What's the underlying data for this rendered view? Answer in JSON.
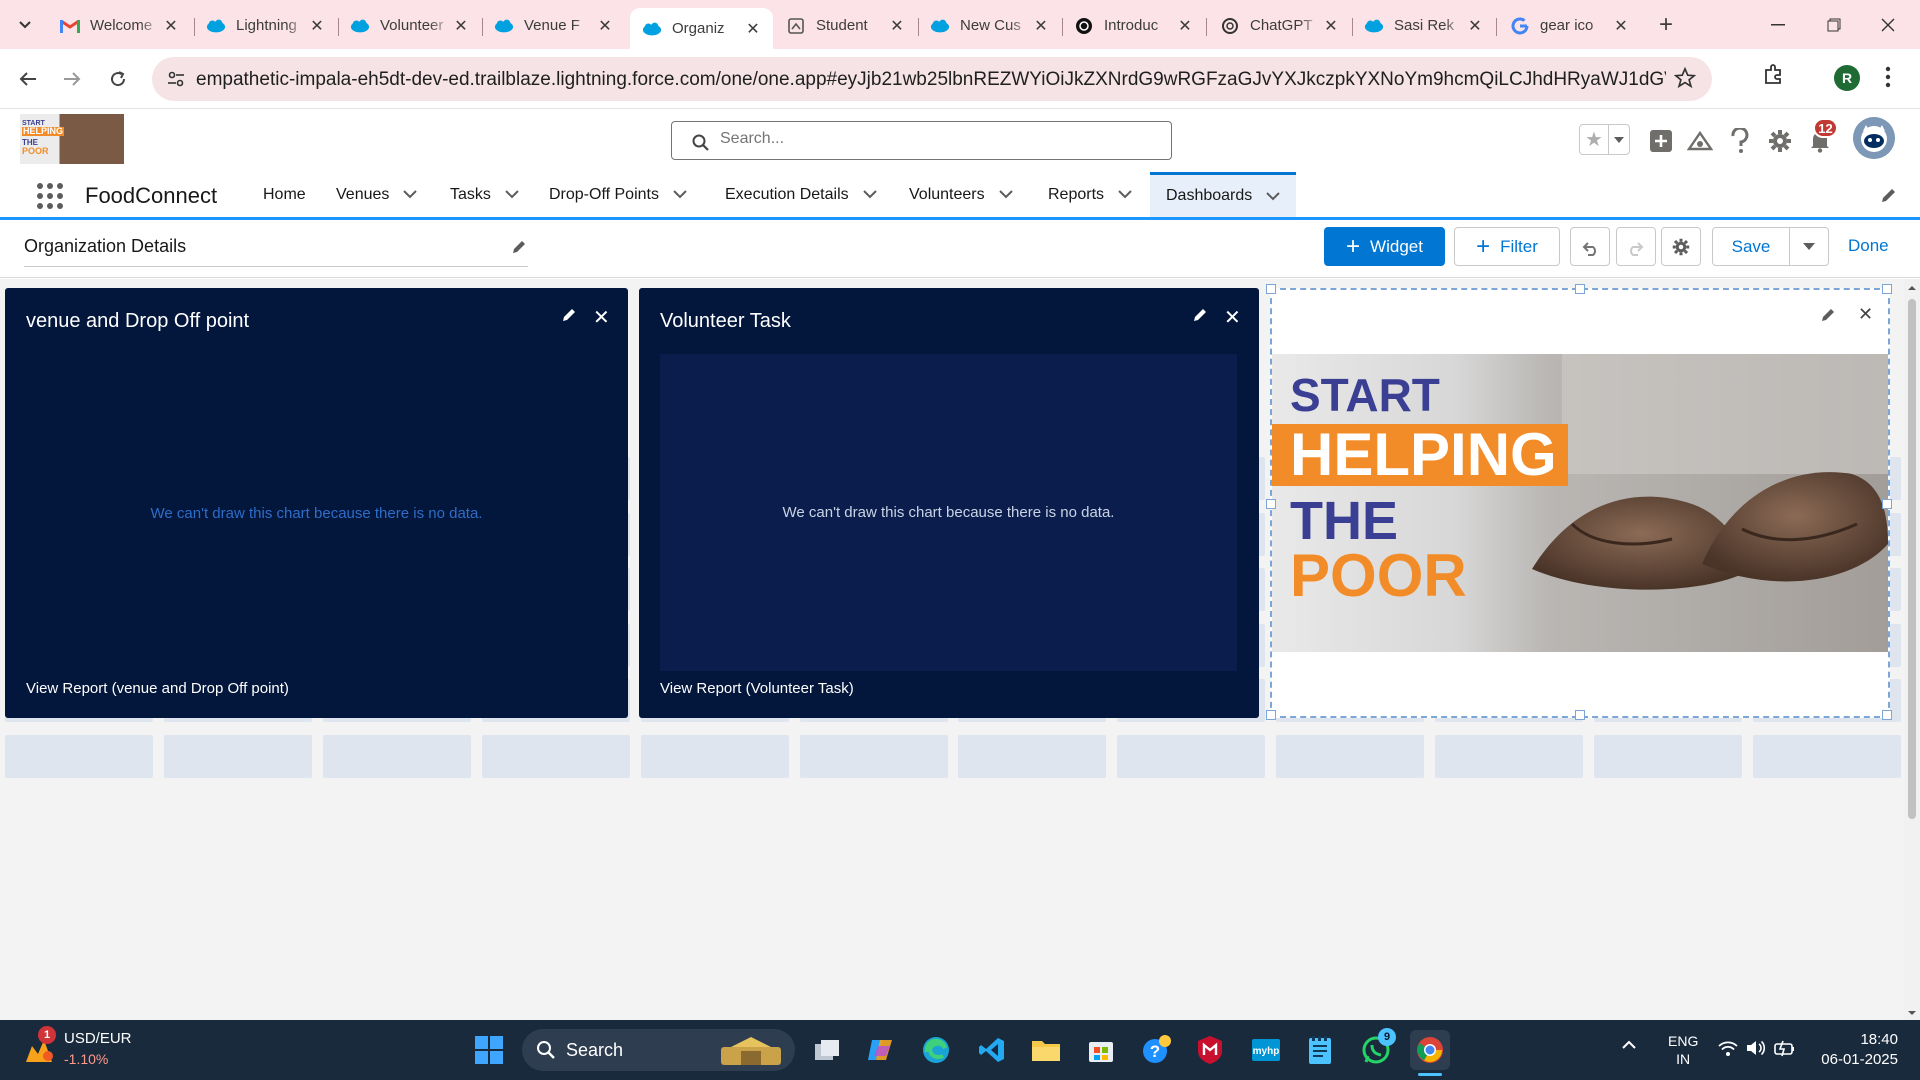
{
  "browser": {
    "tabs": [
      {
        "title": "Welcome",
        "icon": "gmail-icon"
      },
      {
        "title": "Lightning",
        "icon": "salesforce-icon"
      },
      {
        "title": "Volunteer",
        "icon": "salesforce-icon"
      },
      {
        "title": "Venue F",
        "icon": "salesforce-icon"
      },
      {
        "title": "Organiz",
        "icon": "salesforce-icon",
        "active": true
      },
      {
        "title": "Student",
        "icon": "document-icon"
      },
      {
        "title": "New Cus",
        "icon": "salesforce-icon"
      },
      {
        "title": "Introduc",
        "icon": "openai-icon"
      },
      {
        "title": "ChatGPT",
        "icon": "openai-icon"
      },
      {
        "title": "Sasi Rek",
        "icon": "salesforce-icon"
      },
      {
        "title": "gear ico",
        "icon": "google-icon"
      }
    ],
    "url": "empathetic-impala-eh5dt-dev-ed.trailblaze.lightning.force.com/one/one.app#eyJjb21wb25lbnREZWYiOiJkZXNrdG9wRGFzaGJvYXJkczpkYXNoYm9hcmQiLCJhdHRyaWJ1dGVzIjp7ImRhc2hib2FyZ...",
    "profile_initial": "R"
  },
  "logo": {
    "line1": "START",
    "line2": "HELPING",
    "line3": "THE",
    "line4": "POOR"
  },
  "search": {
    "placeholder": "Search..."
  },
  "header": {
    "notification_count": "12"
  },
  "app": {
    "name": "FoodConnect",
    "nav": [
      {
        "label": "Home",
        "dropdown": false
      },
      {
        "label": "Venues",
        "dropdown": true
      },
      {
        "label": "Tasks",
        "dropdown": true
      },
      {
        "label": "Drop-Off Points",
        "dropdown": true
      },
      {
        "label": "Execution Details",
        "dropdown": true
      },
      {
        "label": "Volunteers",
        "dropdown": true
      },
      {
        "label": "Reports",
        "dropdown": true
      },
      {
        "label": "Dashboards",
        "dropdown": true,
        "active": true
      }
    ]
  },
  "toolbar": {
    "dashboard_name": "Organization Details",
    "widget_label": "Widget",
    "filter_label": "Filter",
    "save_label": "Save",
    "done_label": "Done"
  },
  "widgets": [
    {
      "title": "venue and Drop Off point",
      "no_data": "We can't draw this chart because there is no data.",
      "view_report": "View Report (venue and Drop Off point)"
    },
    {
      "title": "Volunteer Task",
      "no_data": "We can't draw this chart because there is no data.",
      "view_report": "View Report (Volunteer Task)"
    }
  ],
  "image_widget": {
    "line1": "START",
    "line2": "HELPING",
    "line3": "THE",
    "line4": "POOR"
  },
  "taskbar": {
    "stock_symbol": "USD/EUR",
    "stock_change": "-1.10%",
    "stock_badge": "1",
    "search_label": "Search",
    "whatsapp_badge": "9",
    "lang_line1": "ENG",
    "lang_line2": "IN",
    "time": "18:40",
    "date": "06-01-2025"
  },
  "colors": {
    "accent": "#0176d3",
    "widget_bg": "#03163b",
    "tab_strip": "#fbe3e7",
    "orange": "#f28c28",
    "indigo": "#3b3f94"
  }
}
